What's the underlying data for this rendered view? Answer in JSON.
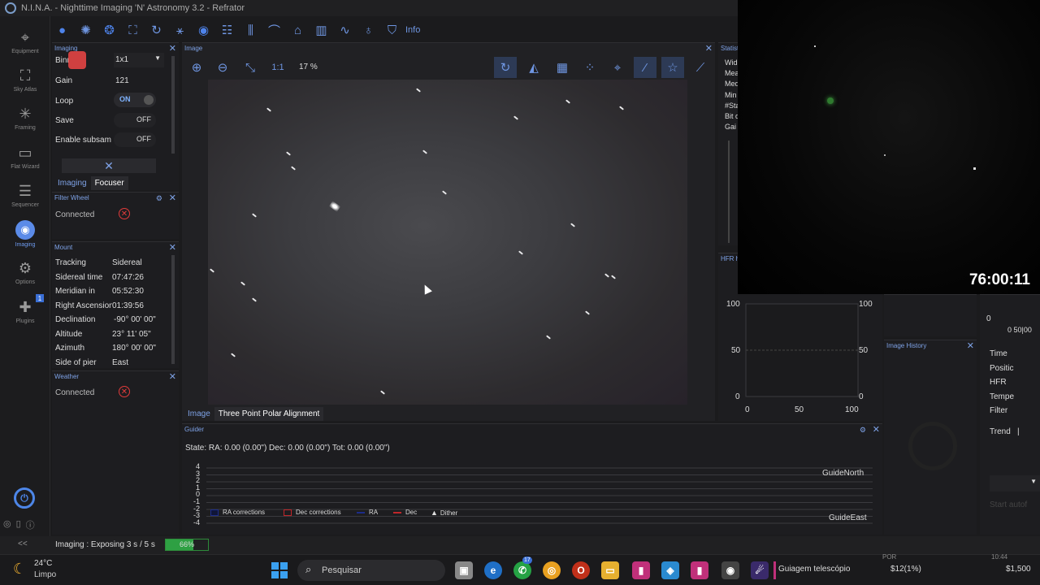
{
  "window": {
    "title": "N.I.N.A. - Nighttime Imaging 'N' Astronomy 3.2   -   Refrator"
  },
  "nav": {
    "items": [
      {
        "label": "Equipment",
        "icon": "equipment-icon"
      },
      {
        "label": "Sky Atlas",
        "icon": "sky-atlas-icon"
      },
      {
        "label": "Framing",
        "icon": "framing-icon"
      },
      {
        "label": "Flat Wizard",
        "icon": "flat-wizard-icon"
      },
      {
        "label": "Sequencer",
        "icon": "sequencer-icon"
      },
      {
        "label": "Imaging",
        "icon": "imaging-icon"
      },
      {
        "label": "Options",
        "icon": "options-icon"
      },
      {
        "label": "Plugins",
        "icon": "plugins-icon"
      }
    ],
    "plugins_badge": "1",
    "collapse_label": "<<"
  },
  "toolbar": {
    "info_label": "Info"
  },
  "imaging_panel": {
    "title": "Imaging",
    "rows": [
      {
        "label": "Binning",
        "value": "1x1"
      },
      {
        "label": "Gain",
        "value": "121"
      },
      {
        "label": "Loop",
        "value": "ON"
      },
      {
        "label": "Save",
        "value": "OFF"
      },
      {
        "label": "Enable subsam",
        "value": "OFF"
      }
    ],
    "tabs": [
      "Imaging",
      "Focuser"
    ]
  },
  "filter_wheel": {
    "title": "Filter Wheel",
    "status": "Connected"
  },
  "mount": {
    "title": "Mount",
    "rows": [
      {
        "label": "Tracking",
        "value": "Sidereal"
      },
      {
        "label": "Sidereal time",
        "value": "07:47:26"
      },
      {
        "label": "Meridian in",
        "value": "05:52:30"
      },
      {
        "label": "Right Ascension",
        "value": "01:39:56"
      },
      {
        "label": "Declination",
        "value": "-90° 00' 00\""
      },
      {
        "label": "Altitude",
        "value": "23° 11' 05\""
      },
      {
        "label": "Azimuth",
        "value": "180° 00' 00\""
      },
      {
        "label": "Side of pier",
        "value": "East"
      }
    ]
  },
  "weather": {
    "title": "Weather",
    "status": "Connected"
  },
  "image_panel": {
    "title": "Image",
    "zoom_1to1": "1:1",
    "zoom_percent": "17 %",
    "tabs": [
      "Image",
      "Three Point Polar Alignment"
    ]
  },
  "statistics": {
    "title": "Statisti",
    "labels": [
      "Wid",
      "Mea",
      "Med",
      "Min",
      "#Sta",
      "Bit d",
      "Gai"
    ]
  },
  "hfr_panel": {
    "title": "HFR h",
    "left_ticks": [
      "100",
      "50",
      "0"
    ],
    "right_ticks": [
      "100",
      "50",
      "0"
    ],
    "x_ticks": [
      "0",
      "50",
      "100"
    ]
  },
  "image_history": {
    "title": "Image History"
  },
  "right_column": {
    "rows": [
      "Time",
      "Positic",
      "HFR",
      "Tempe",
      "Filter",
      "Trend"
    ],
    "tick_labels": {
      "zero": "0",
      "bottom": "0 50|00"
    },
    "start_button": "Start autof",
    "trend_value": "|"
  },
  "guider": {
    "title": "Guider",
    "state": "State:   RA: 0.00 (0.00\")  Dec: 0.00 (0.00\")  Tot: 0.00 (0.00\")",
    "y_ticks": [
      "4",
      "3",
      "2",
      "1",
      "0",
      "-1",
      "-2",
      "-3",
      "-4"
    ],
    "guide_north": "GuideNorth",
    "guide_east": "GuideEast",
    "legend": [
      {
        "label": "RA corrections",
        "color": "#1c2c8a"
      },
      {
        "label": "Dec corrections",
        "color": "#c0262a"
      },
      {
        "label": "RA",
        "color": "#1c2c8a"
      },
      {
        "label": "Dec",
        "color": "#c0262a"
      },
      {
        "label": "Dither",
        "color": "#ffffff"
      }
    ]
  },
  "status_bar": {
    "imaging_text": "Imaging :   Exposing 3 s / 5 s",
    "progress_label": "66%",
    "progress_value": 0.66
  },
  "webcam": {
    "timer": "76:00:11"
  },
  "taskbar": {
    "weather_temp": "24°C",
    "weather_desc": "Limpo",
    "search_placeholder": "Pesquisar",
    "whatsapp_badge": "17",
    "active_window": "Guiagem telescópio",
    "price1": "$12(1%)",
    "price2": "$1,500",
    "clock_fragment": "10:44",
    "lang_fragment": "POR"
  },
  "colors": {
    "accent": "#6f96e2",
    "error": "#e23b3b",
    "progress": "#2ea043"
  }
}
